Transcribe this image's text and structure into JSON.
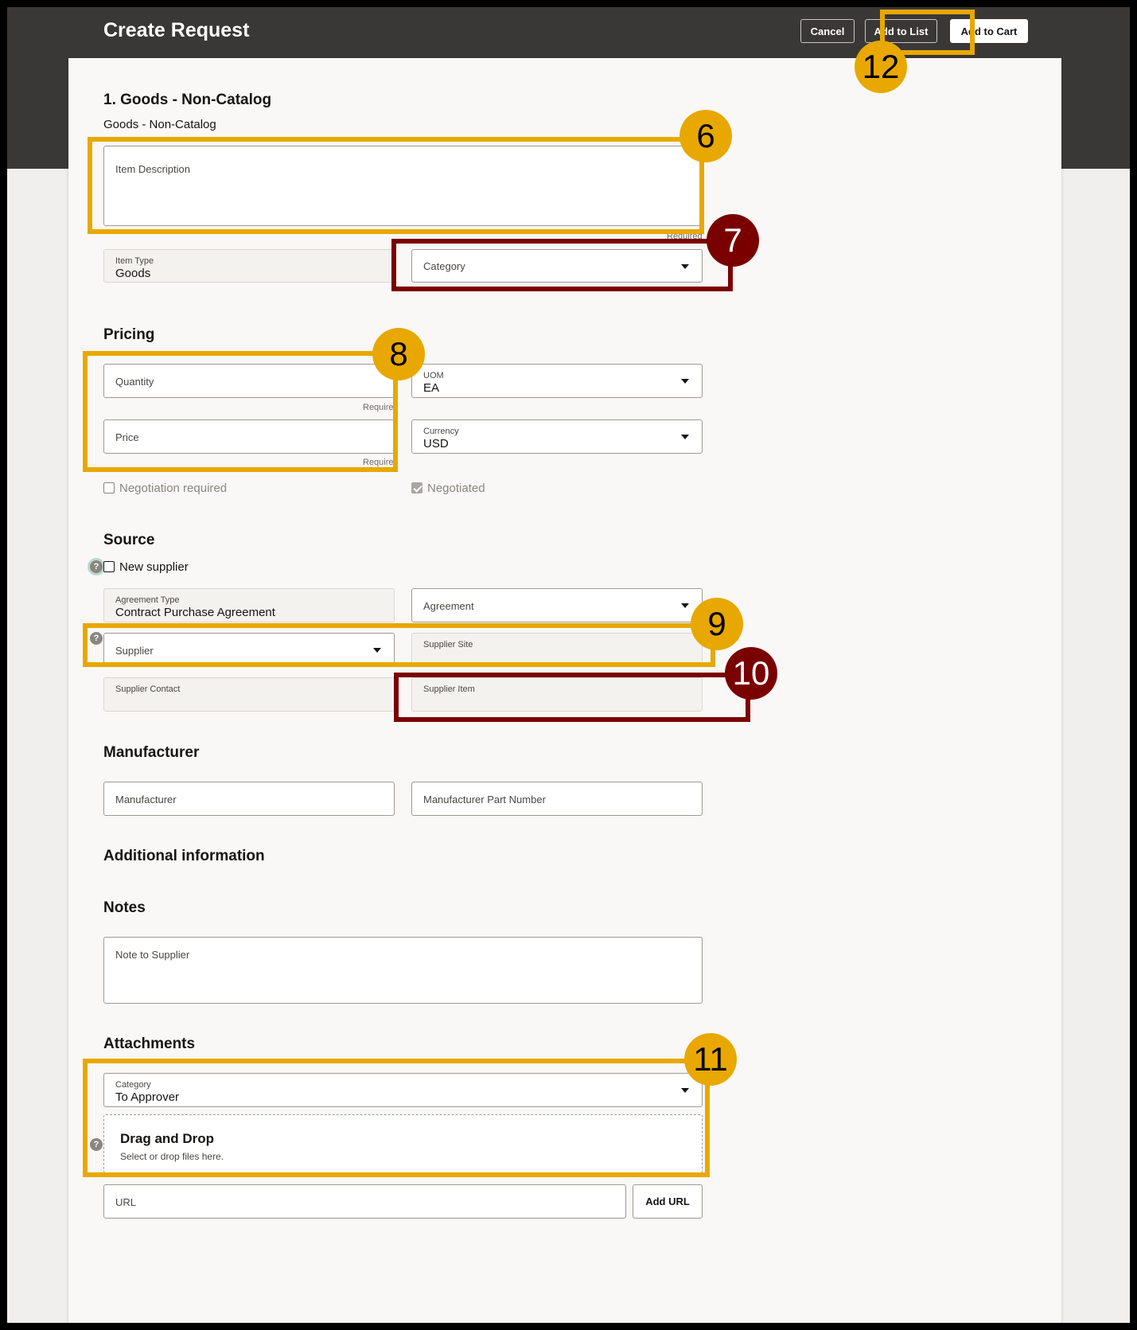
{
  "header": {
    "title": "Create Request",
    "cancel": "Cancel",
    "add_to_list": "Add to List",
    "add_to_cart": "Add to Cart"
  },
  "line": {
    "heading": "1. Goods - Non-Catalog",
    "subtitle": "Goods - Non-Catalog",
    "item_description": {
      "label": "Item Description",
      "required_text": "Required"
    },
    "item_type": {
      "label": "Item Type",
      "value": "Goods"
    },
    "category": {
      "label": "Category"
    }
  },
  "pricing": {
    "heading": "Pricing",
    "quantity": {
      "label": "Quantity",
      "required_text": "Required"
    },
    "price": {
      "label": "Price",
      "required_text": "Required"
    },
    "uom": {
      "label": "UOM",
      "value": "EA"
    },
    "currency": {
      "label": "Currency",
      "value": "USD"
    },
    "negotiation_required": {
      "label": "Negotiation required",
      "checked": false
    },
    "negotiated": {
      "label": "Negotiated",
      "checked": true
    }
  },
  "source": {
    "heading": "Source",
    "new_supplier": {
      "label": "New supplier",
      "checked": false
    },
    "agreement_type": {
      "label": "Agreement Type",
      "value": "Contract Purchase Agreement"
    },
    "agreement": {
      "label": "Agreement"
    },
    "supplier": {
      "label": "Supplier"
    },
    "supplier_site": {
      "label": "Supplier Site"
    },
    "supplier_contact": {
      "label": "Supplier Contact"
    },
    "supplier_item": {
      "label": "Supplier Item"
    }
  },
  "manufacturer": {
    "heading": "Manufacturer",
    "manufacturer": {
      "label": "Manufacturer"
    },
    "part_number": {
      "label": "Manufacturer Part Number"
    }
  },
  "additional": {
    "heading": "Additional information"
  },
  "notes": {
    "heading": "Notes",
    "note_to_supplier": {
      "label": "Note to Supplier"
    }
  },
  "attachments": {
    "heading": "Attachments",
    "category": {
      "label": "Category",
      "value": "To Approver"
    },
    "dropzone": {
      "title": "Drag and Drop",
      "hint": "Select or drop files here."
    },
    "url": {
      "label": "URL"
    },
    "add_url": "Add URL"
  },
  "callouts": {
    "c6": "6",
    "c7": "7",
    "c8": "8",
    "c9": "9",
    "c10": "10",
    "c11": "11",
    "c12": "12"
  },
  "colors": {
    "header_bg": "#3a3836",
    "highlight_yellow": "#e8a800",
    "highlight_red": "#7a0000"
  }
}
